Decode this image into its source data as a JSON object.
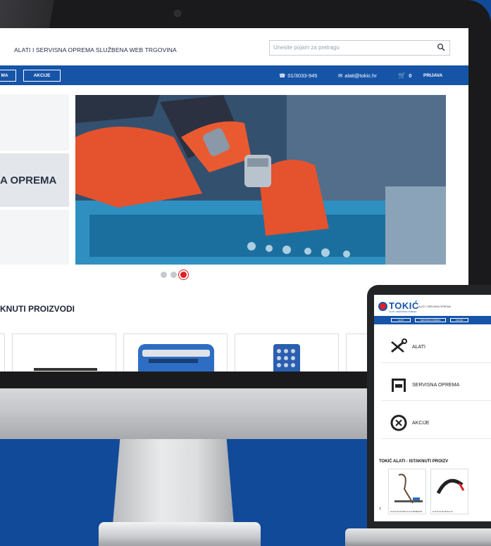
{
  "site": {
    "tagline": "ALATI I SERVISNA OPREMA SLUŽBENA WEB TRGOVINA",
    "search_placeholder": "Unesite pojam za pretragu"
  },
  "nav": {
    "left_buttons": [
      "MA",
      "AKCIJE"
    ],
    "phone": "01/3033-945",
    "email": "alati@tokic.hr",
    "cart_count": "0",
    "login": "PRIJAVA"
  },
  "categories_visible": {
    "mid_label": "A OPREMA"
  },
  "slider": {
    "dots": 3,
    "active_index": 2
  },
  "featured": {
    "title": "KNUTI PROIZVODI"
  },
  "laptop": {
    "logo": "TOKIĆ",
    "logo_sub": "ALATI I SERVISNA OPREMA",
    "tagline": "ALATI I SERVISNA OPREMA",
    "nav_buttons": [
      "ALATI",
      "SERVISNA OPREMA",
      "AKCIJE"
    ],
    "categories": [
      {
        "label": "ALATI",
        "icon": "wrench-icon"
      },
      {
        "label": "SERVISNA OPREMA",
        "icon": "lift-icon"
      },
      {
        "label": "AKCIJE",
        "icon": "discount-icon"
      }
    ],
    "featured_title": "TOKIĆ ALATI - ISTAKNUTI PROIZV",
    "products": [
      {
        "label": "KLJUČ ZA FILTER ULJA S REMENOM"
      },
      {
        "label": "KLJUČ ZA FILTER ULJA"
      }
    ]
  },
  "colors": {
    "brand_blue": "#1654a8",
    "accent_red": "#e11f26",
    "background": "#124a9a"
  }
}
